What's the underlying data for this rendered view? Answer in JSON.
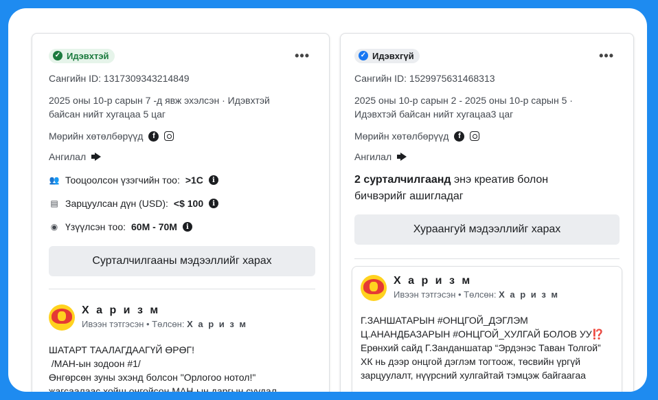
{
  "left": {
    "status": "Идэвхтэй",
    "library_id": "Сангийн ID: 1317309343214849",
    "run_info": "2025 оны 10-р сарын 7 -д явж эхэлсэн · Идэвхтэй байсан нийт хугацаа 5 цаг",
    "platforms_label": "Мөрийн хөтөлбөрүүд",
    "category_label": "Ангилал",
    "metrics": [
      {
        "label": "Тооцоолсон үзэгчийн тоо:",
        "value": ">1С",
        "icon": "people-icon"
      },
      {
        "label": "Зарцуулсан дүн (USD):",
        "value": "<$ 100",
        "icon": "money-icon"
      },
      {
        "label": "Үзүүлсэн тоо:",
        "value": "60М - 70М",
        "icon": "eye-icon"
      }
    ],
    "button": "Сурталчилгааны мэдээллийг харах",
    "advertiser": {
      "name": "Х а р и з м",
      "sub_prefix": "Ивээн тэтгэсэн • Төлсөн:",
      "sub_name": "Х а р и з м"
    },
    "body_lines": [
      "ШАТАРТ ТААЛАГДААГҮЙ ӨРӨГ!",
      " /МАН-ын зодоон #1/",
      "Өнгөрсөн зуны эхэнд болсон \"Орлогоо нотол!\"",
      "жагсаалаас хойш онгойсон МАН-ын даргын суудал"
    ]
  },
  "right": {
    "status": "Идэвхгүй",
    "library_id": "Сангийн ID: 1529975631468313",
    "run_info": "2025 оны 10-р сарын 2 - 2025 оны 10-р сарын 5 · Идэвхтэй байсан нийт хугацаа3 цаг",
    "platforms_label": "Мөрийн хөтөлбөрүүд",
    "category_label": "Ангилал",
    "uses_bold": "2 сурталчилгаанд",
    "uses_rest": " энэ креатив болон бичвэрийг ашигладаг",
    "button": "Хураангуй мэдээллийг харах",
    "advertiser": {
      "name": "Х а р и з м",
      "sub_prefix": "Ивээн тэтгэсэн • Төлсөн:",
      "sub_name": "Х а р и з м"
    },
    "body_lines": [
      "Г.ЗАНШАТАРЫН #ОНЦГОЙ_ДЭГЛЭМ",
      "Ц.АНАНДБАЗАРЫН #ОНЦГОЙ_ХУЛГАЙ БОЛОВ УУ⁉️",
      "Ерөнхий сайд Г.Занданшатар “Эрдэнэс Таван Толгой”",
      "ХК нь дээр онцгой дэглэм тогтоож, төсвийн үргүй",
      "зарцуулалт, нүүрсний хулгайтай тэмцэж байгаагаа"
    ]
  },
  "colors": {
    "frame": "#1e8bf0",
    "active_green": "#1b7a3e",
    "inactive_blue": "#1877f2"
  }
}
